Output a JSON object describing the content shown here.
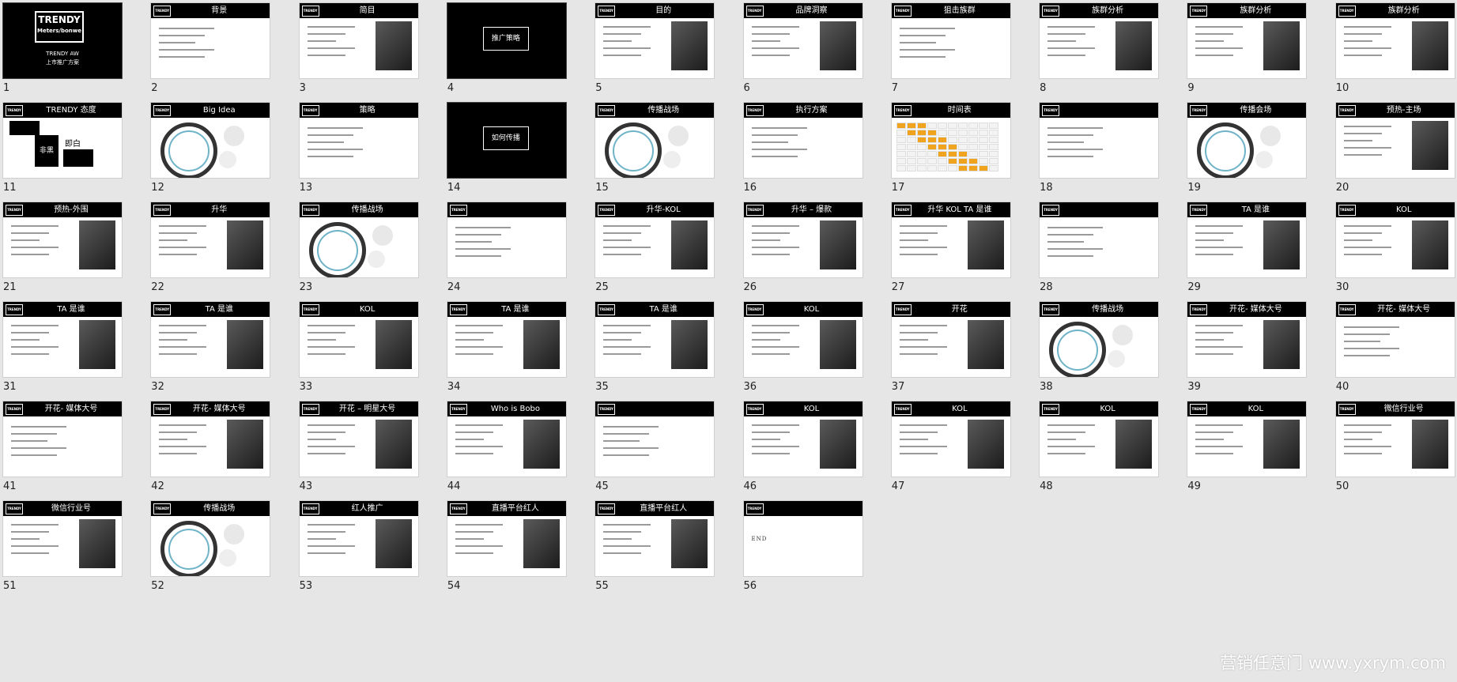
{
  "watermark": "营销任意门 www.yxrym.com",
  "logo_text": "TRENDY",
  "end_text": "END",
  "slides": [
    {
      "n": "1",
      "layout": "cover",
      "title": "",
      "cover": {
        "logo_line1": "TRENDY",
        "logo_line2": "Meters/bonwe",
        "sub1": "TRENDY AW",
        "sub2": "上市推广方案"
      }
    },
    {
      "n": "2",
      "layout": "text",
      "title": "背景"
    },
    {
      "n": "3",
      "layout": "photo",
      "title": "简目"
    },
    {
      "n": "4",
      "layout": "section",
      "title": "推广策略"
    },
    {
      "n": "5",
      "layout": "photo",
      "title": "目的"
    },
    {
      "n": "6",
      "layout": "photo",
      "title": "品牌洞察"
    },
    {
      "n": "7",
      "layout": "text",
      "title": "狙击族群"
    },
    {
      "n": "8",
      "layout": "photo",
      "title": "族群分析"
    },
    {
      "n": "9",
      "layout": "photo",
      "title": "族群分析"
    },
    {
      "n": "10",
      "layout": "photo",
      "title": "族群分析"
    },
    {
      "n": "11",
      "layout": "attitude",
      "title": "TRENDY 态度",
      "attitude": {
        "left": "非黑",
        "mid": "即白"
      }
    },
    {
      "n": "12",
      "layout": "circle",
      "title": "Big Idea"
    },
    {
      "n": "13",
      "layout": "text",
      "title": "策略"
    },
    {
      "n": "14",
      "layout": "section",
      "title": "如何传播"
    },
    {
      "n": "15",
      "layout": "circle",
      "title": "传播战场"
    },
    {
      "n": "16",
      "layout": "text",
      "title": "执行方案"
    },
    {
      "n": "17",
      "layout": "table",
      "title": "时间表"
    },
    {
      "n": "18",
      "layout": "text",
      "title": ""
    },
    {
      "n": "19",
      "layout": "circle",
      "title": "传播会场"
    },
    {
      "n": "20",
      "layout": "photo",
      "title": "预热-主场"
    },
    {
      "n": "21",
      "layout": "photo",
      "title": "预热-外围"
    },
    {
      "n": "22",
      "layout": "photo",
      "title": "升华"
    },
    {
      "n": "23",
      "layout": "circle",
      "title": "传播战场"
    },
    {
      "n": "24",
      "layout": "text",
      "title": ""
    },
    {
      "n": "25",
      "layout": "photo",
      "title": "升华-KOL"
    },
    {
      "n": "26",
      "layout": "photo",
      "title": "升华 – 爆款"
    },
    {
      "n": "27",
      "layout": "photo",
      "title": "升华 KOL TA 是谁"
    },
    {
      "n": "28",
      "layout": "text",
      "title": ""
    },
    {
      "n": "29",
      "layout": "photo",
      "title": "TA 是谁"
    },
    {
      "n": "30",
      "layout": "photo",
      "title": "KOL"
    },
    {
      "n": "31",
      "layout": "photo",
      "title": "TA 是谁"
    },
    {
      "n": "32",
      "layout": "photo",
      "title": "TA 是谁"
    },
    {
      "n": "33",
      "layout": "photo",
      "title": "KOL"
    },
    {
      "n": "34",
      "layout": "photo",
      "title": "TA 是谁"
    },
    {
      "n": "35",
      "layout": "photo",
      "title": "TA 是谁"
    },
    {
      "n": "36",
      "layout": "photo",
      "title": "KOL"
    },
    {
      "n": "37",
      "layout": "photo",
      "title": "开花"
    },
    {
      "n": "38",
      "layout": "circle",
      "title": "传播战场"
    },
    {
      "n": "39",
      "layout": "photo",
      "title": "开花- 媒体大号"
    },
    {
      "n": "40",
      "layout": "text",
      "title": "开花- 媒体大号"
    },
    {
      "n": "41",
      "layout": "text",
      "title": "开花- 媒体大号"
    },
    {
      "n": "42",
      "layout": "photo",
      "title": "开花- 媒体大号"
    },
    {
      "n": "43",
      "layout": "photo",
      "title": "开花 – 明星大号"
    },
    {
      "n": "44",
      "layout": "photo",
      "title": "Who is Bobo"
    },
    {
      "n": "45",
      "layout": "text",
      "title": ""
    },
    {
      "n": "46",
      "layout": "photo",
      "title": "KOL"
    },
    {
      "n": "47",
      "layout": "photo",
      "title": "KOL"
    },
    {
      "n": "48",
      "layout": "photo",
      "title": "KOL"
    },
    {
      "n": "49",
      "layout": "photo",
      "title": "KOL"
    },
    {
      "n": "50",
      "layout": "photo",
      "title": "微信行业号"
    },
    {
      "n": "51",
      "layout": "photo",
      "title": "微信行业号"
    },
    {
      "n": "52",
      "layout": "circle",
      "title": "传播战场"
    },
    {
      "n": "53",
      "layout": "photo",
      "title": "红人推广"
    },
    {
      "n": "54",
      "layout": "photo",
      "title": "直播平台红人"
    },
    {
      "n": "55",
      "layout": "photo",
      "title": "直播平台红人"
    },
    {
      "n": "56",
      "layout": "end",
      "title": ""
    }
  ]
}
